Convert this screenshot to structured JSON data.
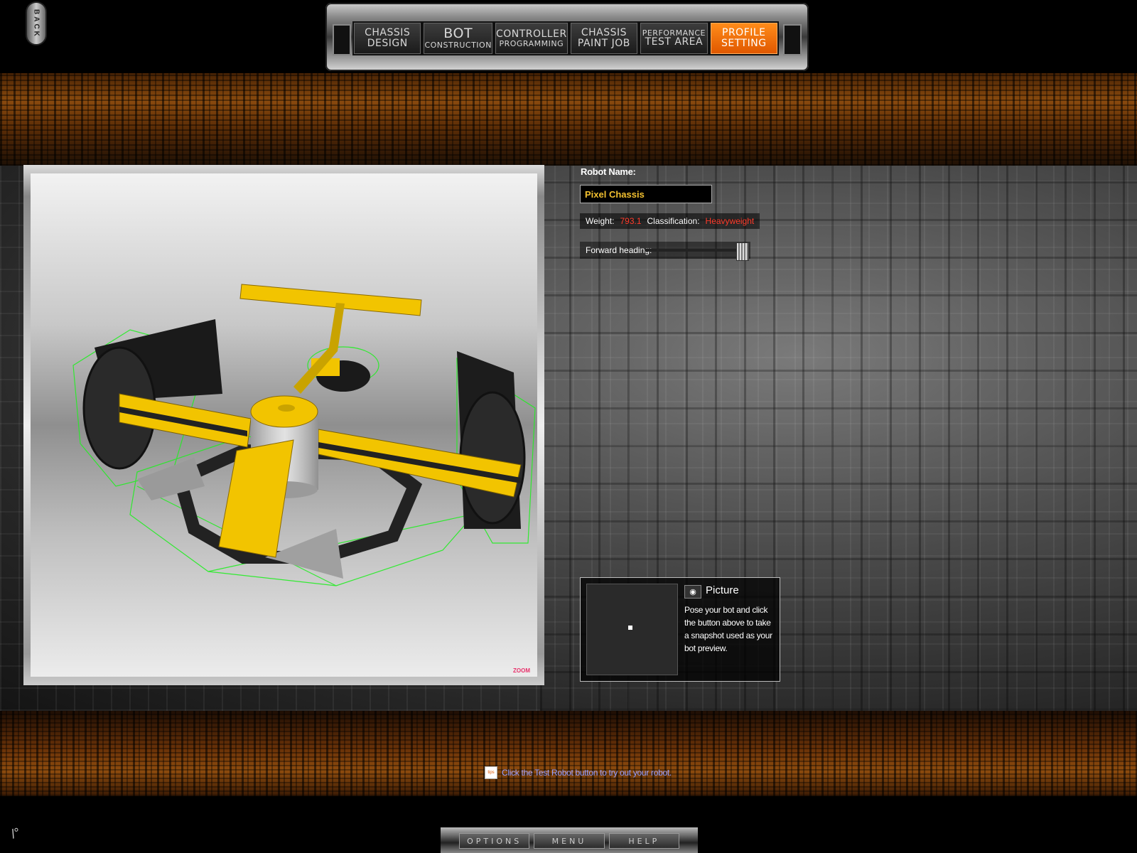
{
  "back_label": "BACK",
  "nav": {
    "tabs": [
      {
        "line1": "CHASSIS",
        "line2": "DESIGN",
        "active": false
      },
      {
        "line1": "BOT",
        "line2": "CONSTRUCTION",
        "active": false
      },
      {
        "line1": "CONTROLLER",
        "line2": "PROGRAMMING",
        "active": false
      },
      {
        "line1": "CHASSIS",
        "line2": "PAINT JOB",
        "active": false
      },
      {
        "line1": "PERFORMANCE",
        "line2": "TEST AREA",
        "active": false
      },
      {
        "line1": "PROFILE",
        "line2": "SETTING",
        "active": true
      }
    ]
  },
  "viewport": {
    "zoom_label": "ZOOM"
  },
  "profile": {
    "robot_name_label": "Robot Name:",
    "robot_name_value": "Pixel Chassis",
    "weight_label": "Weight:",
    "weight_value": "793.1",
    "classification_label": "Classification:",
    "classification_value": "Heavyweight",
    "forward_heading_label": "Forward heading:"
  },
  "picture": {
    "title": "Picture",
    "description": "Pose your bot and click the button above to take a snapshot used as your bot preview."
  },
  "tip": {
    "icon_label": "tips",
    "text": "Click the Test Robot button to try out your robot."
  },
  "bottom": {
    "options_label": "OPTIONS",
    "menu_label": "MENU",
    "help_label": "HELP"
  },
  "colors": {
    "active_tab": "#ff7a10",
    "robot_yellow": "#f2c400",
    "wire_green": "#22ee22",
    "value_red": "#ff3b2a",
    "name_yellow": "#f2c030"
  }
}
